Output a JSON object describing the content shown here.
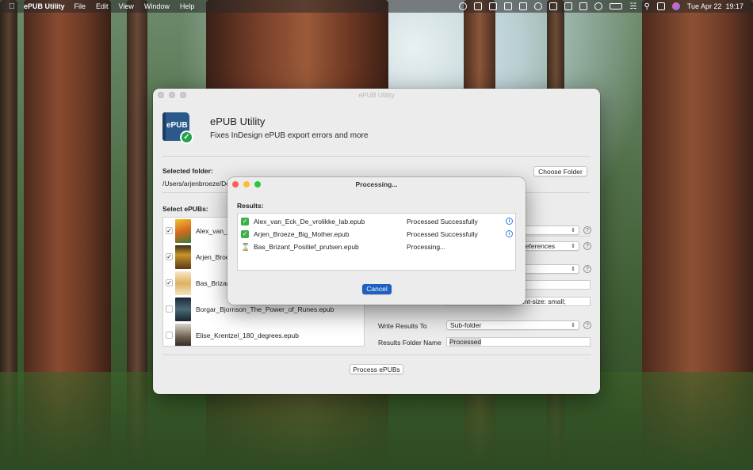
{
  "menubar": {
    "app_name": "ePUB Utility",
    "menus": [
      "File",
      "Edit",
      "View",
      "Window",
      "Help"
    ],
    "clock": "Tue Apr 22  19:17"
  },
  "window": {
    "title": "ePUB Utility",
    "app_title": "ePUB Utility",
    "app_subtitle": "Fixes InDesign ePUB export errors and more",
    "icon_text": "ePUB",
    "selected_folder_label": "Selected folder:",
    "selected_folder_path": "/Users/arjenbroeze/Do",
    "choose_folder_label": "Choose Folder",
    "select_epubs_label": "Select ePUBs:",
    "process_label": "Process ePUBs",
    "epubs": [
      {
        "name": "Alex_van_E",
        "checked": true
      },
      {
        "name": "Arjen_Broe",
        "checked": true
      },
      {
        "name": "Bas_Brizan",
        "checked": true
      },
      {
        "name": "Borgar_Bjornson_The_Power_of_Runes.epub",
        "checked": false
      },
      {
        "name": "Elise_Krentzel_180_degrees.epub",
        "checked": false
      }
    ],
    "options": {
      "select_footnote_partial": "or references",
      "style_partial": "ccc; font-size: small;",
      "write_results_label": "Write Results To",
      "write_results_value": "Sub-folder",
      "results_folder_label": "Results Folder Name",
      "results_folder_value": "Processed"
    }
  },
  "dialog": {
    "title": "Processing...",
    "results_label": "Results:",
    "results": [
      {
        "file": "Alex_van_Eck_De_vrolikke_lab.epub",
        "status": "Processed Successfully",
        "state": "done"
      },
      {
        "file": "Arjen_Broeze_Big_Mother.epub",
        "status": "Processed Successfully",
        "state": "done"
      },
      {
        "file": "Bas_Brizant_Positief_prutsen.epub",
        "status": "Processing...",
        "state": "processing"
      }
    ],
    "cancel_label": "Cancel"
  },
  "colors": {
    "accent": "#1f5fbf",
    "success": "#3bb14a",
    "info": "#2b7de9"
  }
}
